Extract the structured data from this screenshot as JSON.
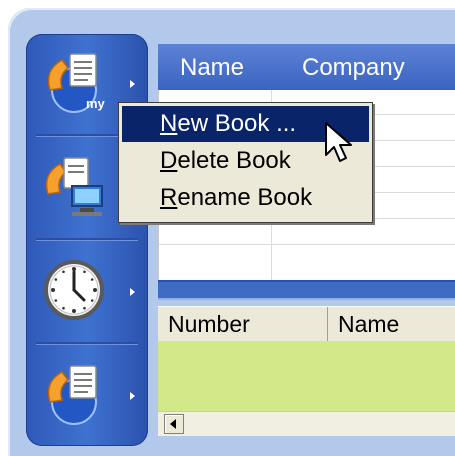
{
  "sidebar": {
    "buttons": [
      {
        "name": "my-phonebook",
        "icon": "phone-book-icon",
        "badge": "my"
      },
      {
        "name": "network-phonebook",
        "icon": "phone-network-icon"
      },
      {
        "name": "history",
        "icon": "clock-icon"
      },
      {
        "name": "phonebook",
        "icon": "phone-book-icon"
      }
    ]
  },
  "upper_table": {
    "columns": [
      "Name",
      "Company"
    ]
  },
  "lower_table": {
    "columns": [
      "Number",
      "Name"
    ]
  },
  "context_menu": {
    "items": [
      {
        "accel": "N",
        "rest": "ew Book ...",
        "selected": true
      },
      {
        "accel": "D",
        "rest": "elete Book",
        "selected": false
      },
      {
        "accel": "R",
        "rest": "ename Book",
        "selected": false
      }
    ]
  },
  "colors": {
    "menu_highlight": "#0a246a",
    "sidebar_blue": "#3f72d0",
    "lower_body": "#d3e889"
  }
}
